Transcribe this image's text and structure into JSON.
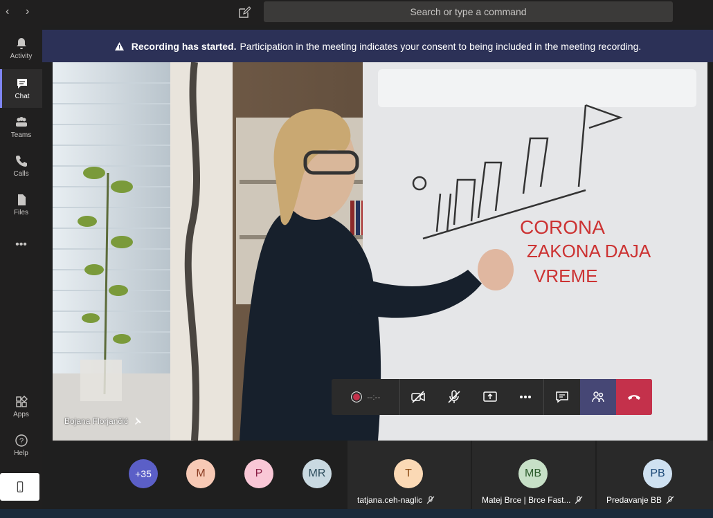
{
  "topbar": {
    "back": "‹",
    "forward": "›",
    "search_placeholder": "Search or type a command"
  },
  "rail": {
    "items": [
      {
        "label": "Activity",
        "icon": "bell-icon"
      },
      {
        "label": "Chat",
        "icon": "chat-icon",
        "active": true
      },
      {
        "label": "Teams",
        "icon": "teams-icon"
      },
      {
        "label": "Calls",
        "icon": "phone-icon"
      },
      {
        "label": "Files",
        "icon": "file-icon"
      },
      {
        "label": "•••",
        "icon": "more-icon"
      }
    ],
    "bottom": [
      {
        "label": "Apps",
        "icon": "apps-icon"
      },
      {
        "label": "Help",
        "icon": "help-icon"
      }
    ]
  },
  "banner": {
    "bold": "Recording has started.",
    "text": "Participation in the meeting indicates your consent to being included in the meeting recording."
  },
  "video": {
    "speaker_name": "Bojana Florjančić",
    "whiteboard_text": [
      "CORONA",
      "ZAKONA DAJA",
      "VREME"
    ]
  },
  "controls": {
    "timer": "--:--",
    "record_color": "#c4314b"
  },
  "participants": {
    "overflow": "+35",
    "avatars": [
      {
        "initials": "M",
        "bg": "#f7c9b5",
        "fg": "#8a3b22"
      },
      {
        "initials": "P",
        "bg": "#f9c7d6",
        "fg": "#8a1e45"
      },
      {
        "initials": "MR",
        "bg": "#c9d9e1",
        "fg": "#2b4b5b"
      }
    ],
    "tiles": [
      {
        "initials": "T",
        "name": "tatjana.ceh-naglic",
        "bg": "#fbd9b5",
        "fg": "#8a4a12"
      },
      {
        "initials": "MB",
        "name": "Matej Brce | Brce Fast...",
        "bg": "#c7e0c7",
        "fg": "#2b5b2b"
      },
      {
        "initials": "PB",
        "name": "Predavanje BB",
        "bg": "#cfe1f1",
        "fg": "#1e4b7a"
      }
    ]
  }
}
